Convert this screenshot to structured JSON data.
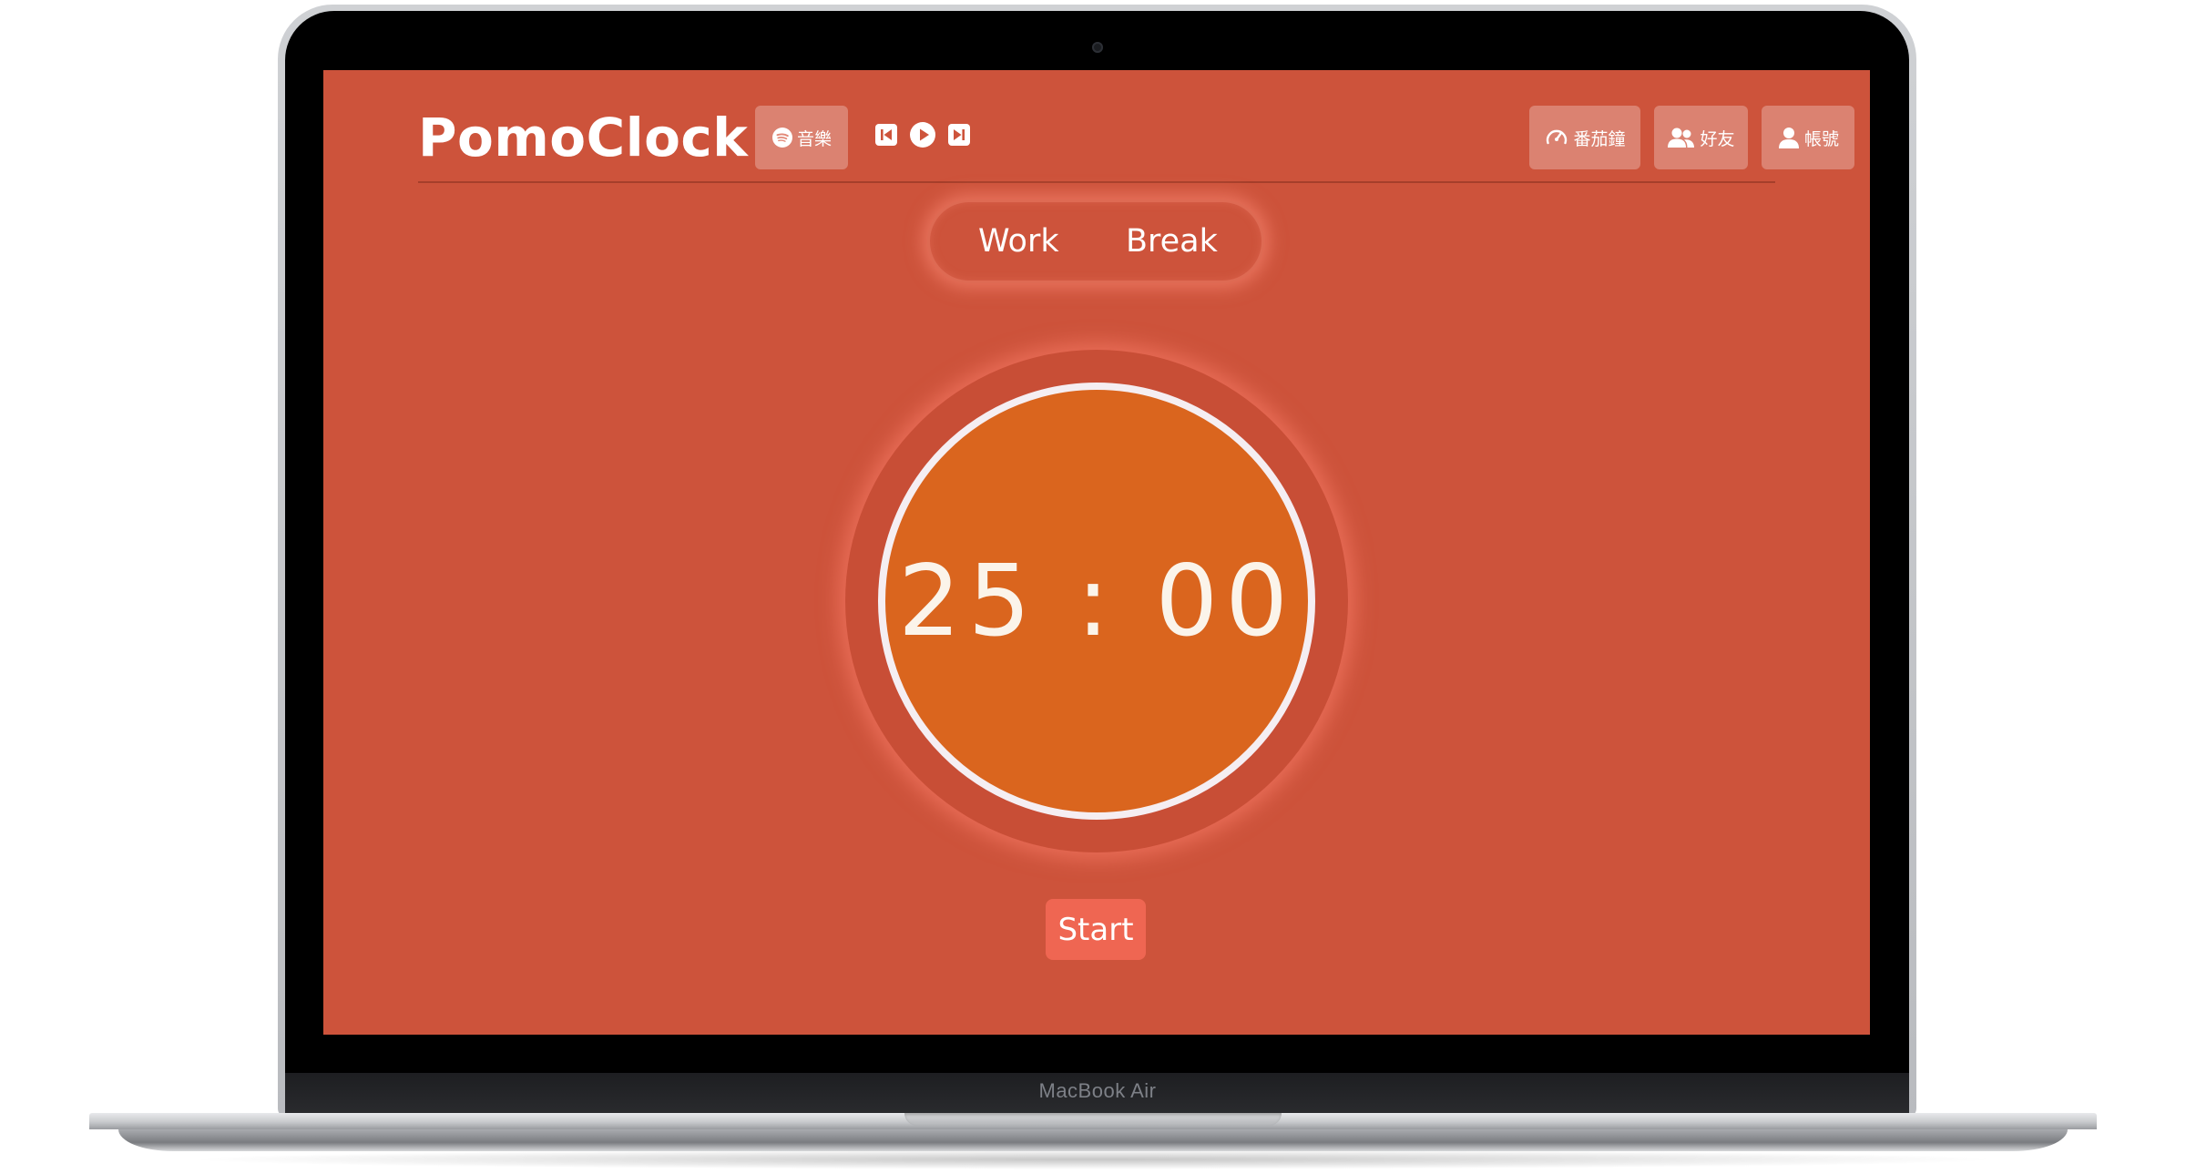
{
  "device": {
    "model_label": "MacBook Air"
  },
  "header": {
    "brand": "PomoClock",
    "music_button": {
      "label": "音樂",
      "icon": "spotify-icon"
    },
    "player_controls": [
      {
        "name": "previous",
        "icon": "skip-previous-icon"
      },
      {
        "name": "play",
        "icon": "play-icon"
      },
      {
        "name": "next",
        "icon": "skip-next-icon"
      }
    ],
    "nav": {
      "pomodoro": {
        "label": "番茄鐘",
        "icon": "speedometer-icon"
      },
      "friends": {
        "label": "好友",
        "icon": "users-icon"
      },
      "account": {
        "label": "帳號",
        "icon": "user-icon"
      }
    }
  },
  "modes": {
    "work": "Work",
    "break": "Break",
    "active": "Work"
  },
  "timer": {
    "display": "25 : 00"
  },
  "controls": {
    "start_label": "Start"
  },
  "colors": {
    "background": "#cd533b",
    "timer_face": "#da651e",
    "timer_ring": "#f5eef2",
    "start_button": "#ef6652",
    "glow": "#ff8c78"
  }
}
